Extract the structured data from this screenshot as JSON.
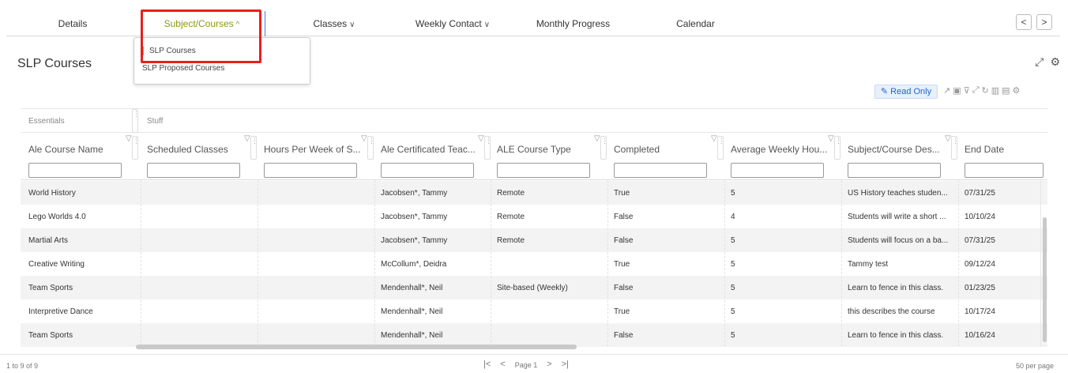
{
  "nav": {
    "tabs": [
      {
        "label": "Details"
      },
      {
        "label": "Subject/Courses",
        "chevron": "^"
      },
      {
        "label": "Classes",
        "chevron": "∨"
      },
      {
        "label": "Weekly Contact",
        "chevron": "∨"
      },
      {
        "label": "Monthly Progress"
      },
      {
        "label": "Calendar"
      }
    ],
    "prev": "<",
    "next": ">"
  },
  "dropdown": {
    "items": [
      "SLP Courses",
      "SLP Proposed Courses"
    ]
  },
  "page_title": "SLP Courses",
  "toolbar": {
    "read_only": "Read Only"
  },
  "grid": {
    "groups": [
      "Essentials",
      "Stuff"
    ],
    "columns": [
      "Ale Course Name",
      "Scheduled Classes",
      "Hours Per Week of S...",
      "Ale Certificated Teac...",
      "ALE Course Type",
      "Completed",
      "Average Weekly Hou...",
      "Subject/Course Des...",
      "End Date"
    ],
    "rows": [
      [
        "World History",
        "",
        "",
        "Jacobsen*, Tammy",
        "Remote",
        "True",
        "5",
        "US History teaches studen...",
        "07/31/25"
      ],
      [
        "Lego Worlds 4.0",
        "",
        "",
        "Jacobsen*, Tammy",
        "Remote",
        "False",
        "4",
        "Students will write a short ...",
        "10/10/24"
      ],
      [
        "Martial Arts",
        "",
        "",
        "Jacobsen*, Tammy",
        "Remote",
        "False",
        "5",
        "Students will focus on a ba...",
        "07/31/25"
      ],
      [
        "Creative Writing",
        "",
        "",
        "McCollum*, Deidra",
        "",
        "True",
        "5",
        "Tammy test",
        "09/12/24"
      ],
      [
        "Team Sports",
        "",
        "",
        "Mendenhall*, Neil",
        "Site-based (Weekly)",
        "False",
        "5",
        "Learn to fence in this class.",
        "01/23/25"
      ],
      [
        "Interpretive Dance",
        "",
        "",
        "Mendenhall*, Neil",
        "",
        "True",
        "5",
        "this describes the course",
        "10/17/24"
      ],
      [
        "Team Sports",
        "",
        "",
        "Mendenhall*, Neil",
        "",
        "False",
        "5",
        "Learn to fence in this class.",
        "10/16/24"
      ]
    ]
  },
  "footer": {
    "count": "1 to 9 of 9",
    "page_label": "Page 1",
    "per_page": "50 per page",
    "first": "|<",
    "prev": "<",
    "next": ">",
    "last": ">|"
  }
}
